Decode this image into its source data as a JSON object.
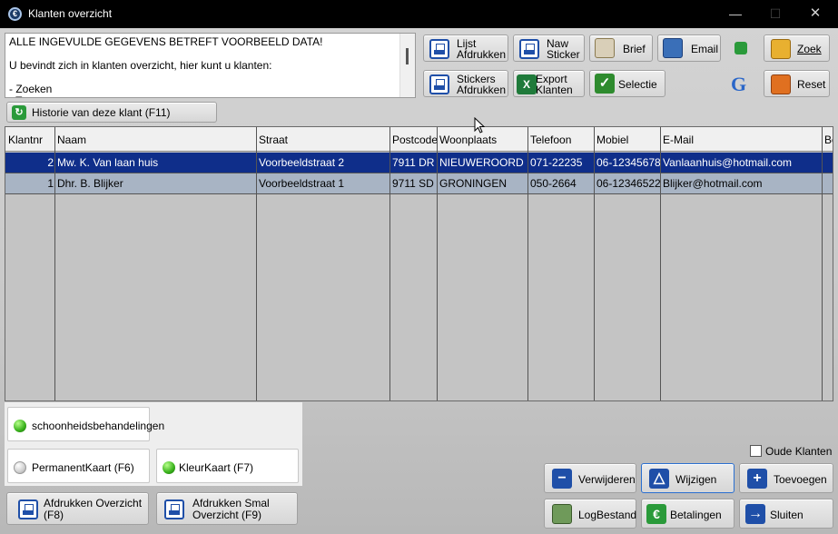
{
  "window": {
    "title": "Klanten overzicht",
    "app_icon": "app-logo-icon",
    "controls": [
      "minimize-icon",
      "maximize-icon",
      "close-icon"
    ],
    "min_glyph": "—",
    "max_glyph": "☐",
    "close_glyph": "✕"
  },
  "info": {
    "lines": [
      "ALLE INGEVULDE GEGEVENS BETREFT VOORBEELD DATA!",
      "U bevindt zich in klanten overzicht, hier kunt u klanten:",
      "- Zoeken",
      "- T"
    ]
  },
  "toolbar": {
    "lijst": "Lijst\nAfdrukken",
    "lijst_l1": "Lijst",
    "lijst_l2": "Afdrukken",
    "naw_l1": "Naw",
    "naw_l2": "Sticker",
    "brief": "Brief",
    "email": "Email",
    "zoek": "Zoek",
    "stickers_l1": "Stickers",
    "stickers_l2": "Afdrukken",
    "export_l1": "Export",
    "export_l2": "Klanten",
    "excel_glyph": "X",
    "selectie": "Selectie",
    "check_glyph": "✓",
    "reset": "Reset",
    "google_glyph": "G",
    "historie": "Historie van deze klant (F11)"
  },
  "table": {
    "columns": [
      "Klantnr",
      "Naam",
      "Straat",
      "Postcode",
      "Woonplaats",
      "Telefoon",
      "Mobiel",
      "E-Mail",
      "Be"
    ],
    "rows": [
      {
        "klantnr": "2",
        "naam": "Mw. K. Van  laan huis",
        "straat": "Voorbeeldstraat 2",
        "postcode": "7911 DR",
        "woonplaats": "NIEUWEROORD",
        "telefoon": "071-22235",
        "mobiel": "06-12345678",
        "email": "Vanlaanhuis@hotmail.com"
      },
      {
        "klantnr": "1",
        "naam": "Dhr. B. Blijker",
        "straat": "Voorbeeldstraat 1",
        "postcode": "9711 SD",
        "woonplaats": "GRONINGEN",
        "telefoon": "050-2664",
        "mobiel": "06-12346522",
        "email": "Blijker@hotmail.com"
      }
    ]
  },
  "cards": {
    "schoonheid": "schoonheidsbehandelingen",
    "permanent": "PermanentKaart (F6)",
    "kleur": "KleurKaart (F7)"
  },
  "print": {
    "overzicht_l1": "Afdrukken Overzicht",
    "overzicht_l2": "(F8)",
    "smal_l1": "Afdrukken Smal",
    "smal_l2": "Overzicht (F9)"
  },
  "oude_klanten": "Oude Klanten",
  "actions": {
    "verwijderen": "Verwijderen",
    "wijzigen": "Wijzigen",
    "toevoegen": "Toevoegen",
    "logbestand": "LogBestand",
    "betalingen": "Betalingen",
    "sluiten": "Sluiten",
    "minus_glyph": "−",
    "plus_glyph": "+",
    "arrow_glyph": "→",
    "euro_glyph": "€",
    "up_glyph": "△"
  }
}
